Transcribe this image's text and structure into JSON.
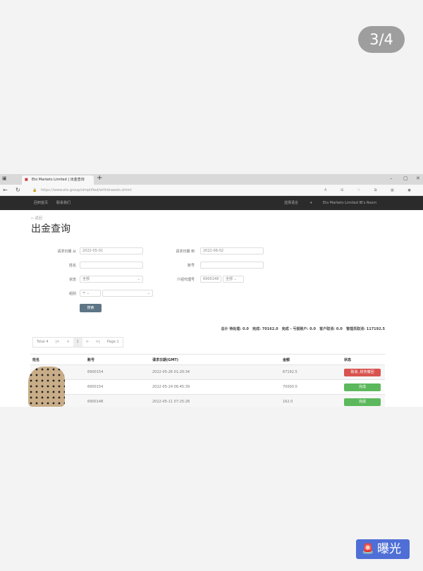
{
  "viewer": {
    "counter": "3/4",
    "expose_label": "曝光",
    "expose_icon": "alarm-light-icon"
  },
  "browser": {
    "tab_title": "Eto Markets Limited | 出金查询",
    "url": "https://www.eto.group/simplified/withdrawals.shtml"
  },
  "nav": {
    "home": "回到首页",
    "contact": "联系我们",
    "language": "选择语言",
    "room": "Eto Markets Limited IB's Room"
  },
  "page": {
    "back": "← 返回",
    "title": "出金查询"
  },
  "form": {
    "date_from_label": "请求日期 从",
    "date_from": "2022-05-01",
    "date_to_label": "请求日期 到",
    "date_to": "2022-06-02",
    "name_label": "姓名",
    "account_label": "账号",
    "status_label": "状态",
    "status_value": "全部",
    "agent_label": "介绍代理号",
    "agent_value": "6900148",
    "agent_scope": "全部",
    "group_label": "组别",
    "group_op": "=",
    "search": "搜索"
  },
  "summary": "总计 待处理: 0.0   完成: 70162.0   完成 - 亏损账户: 0.0   客户取消: 0.0   管理员取消: 117192.5",
  "pager": {
    "total": "Total 4",
    "first": "|<",
    "prev": "<",
    "current": "1",
    "next": ">",
    "last": ">|",
    "page": "Page 1"
  },
  "table": {
    "headers": [
      "姓名",
      "账号",
      "请求日期(GMT)",
      "金额",
      "状态"
    ],
    "rows": [
      {
        "account": "6900154",
        "date": "2022-05-26 01:20:34",
        "amount": "67192.5",
        "status": "取消 ,财务撤回",
        "color": "#d9534f"
      },
      {
        "account": "6900154",
        "date": "2022-05-24 06:45:39",
        "amount": "70000.0",
        "status": "完成",
        "color": "#5cb85c"
      },
      {
        "account": "6900148",
        "date": "2022-05-11 07:25:28",
        "amount": "162.0",
        "status": "完成",
        "color": "#5cb85c"
      }
    ]
  }
}
